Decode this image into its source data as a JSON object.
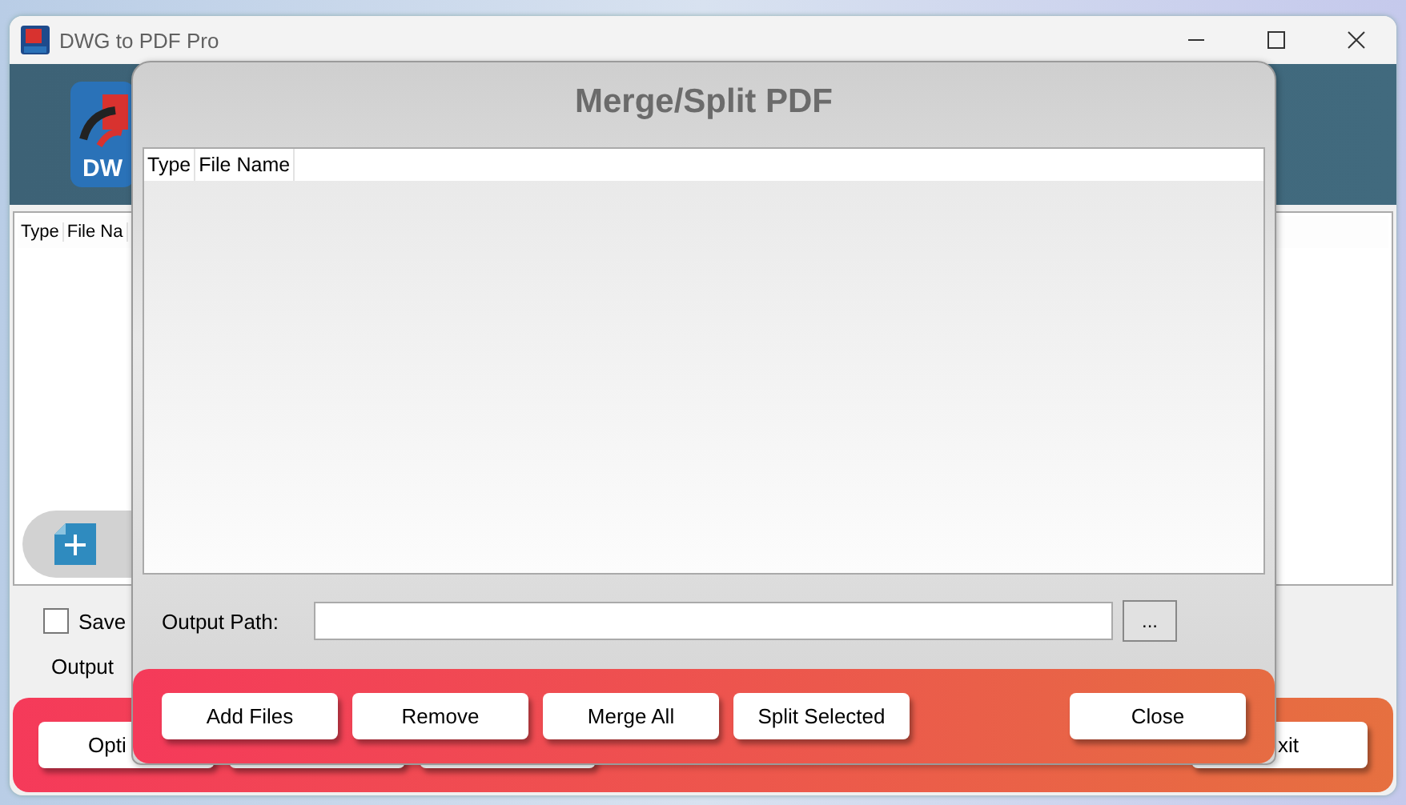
{
  "main_window": {
    "title": "DWG to PDF Pro",
    "logo_text": "DW",
    "file_list": {
      "columns": [
        "Type",
        "File Na"
      ]
    },
    "save_checkbox": {
      "label": "Save",
      "checked": false
    },
    "output_label": "Output",
    "buttons": [
      {
        "kind": "text",
        "label": "Opti"
      },
      {
        "kind": "blank"
      },
      {
        "kind": "blank"
      },
      {
        "kind": "text",
        "label": "xit"
      }
    ]
  },
  "dialog": {
    "title": "Merge/Split PDF",
    "table": {
      "columns": [
        "Type",
        "File Name"
      ]
    },
    "output_path": {
      "label": "Output Path:"
    },
    "browse_button": "...",
    "buttons": [
      {
        "label": "Add Files",
        "kind": "left"
      },
      {
        "label": "Remove",
        "kind": "left"
      },
      {
        "label": "Merge All",
        "kind": "left"
      },
      {
        "label": "Split Selected",
        "kind": "left"
      },
      {
        "label": "Close",
        "kind": "right"
      }
    ]
  }
}
